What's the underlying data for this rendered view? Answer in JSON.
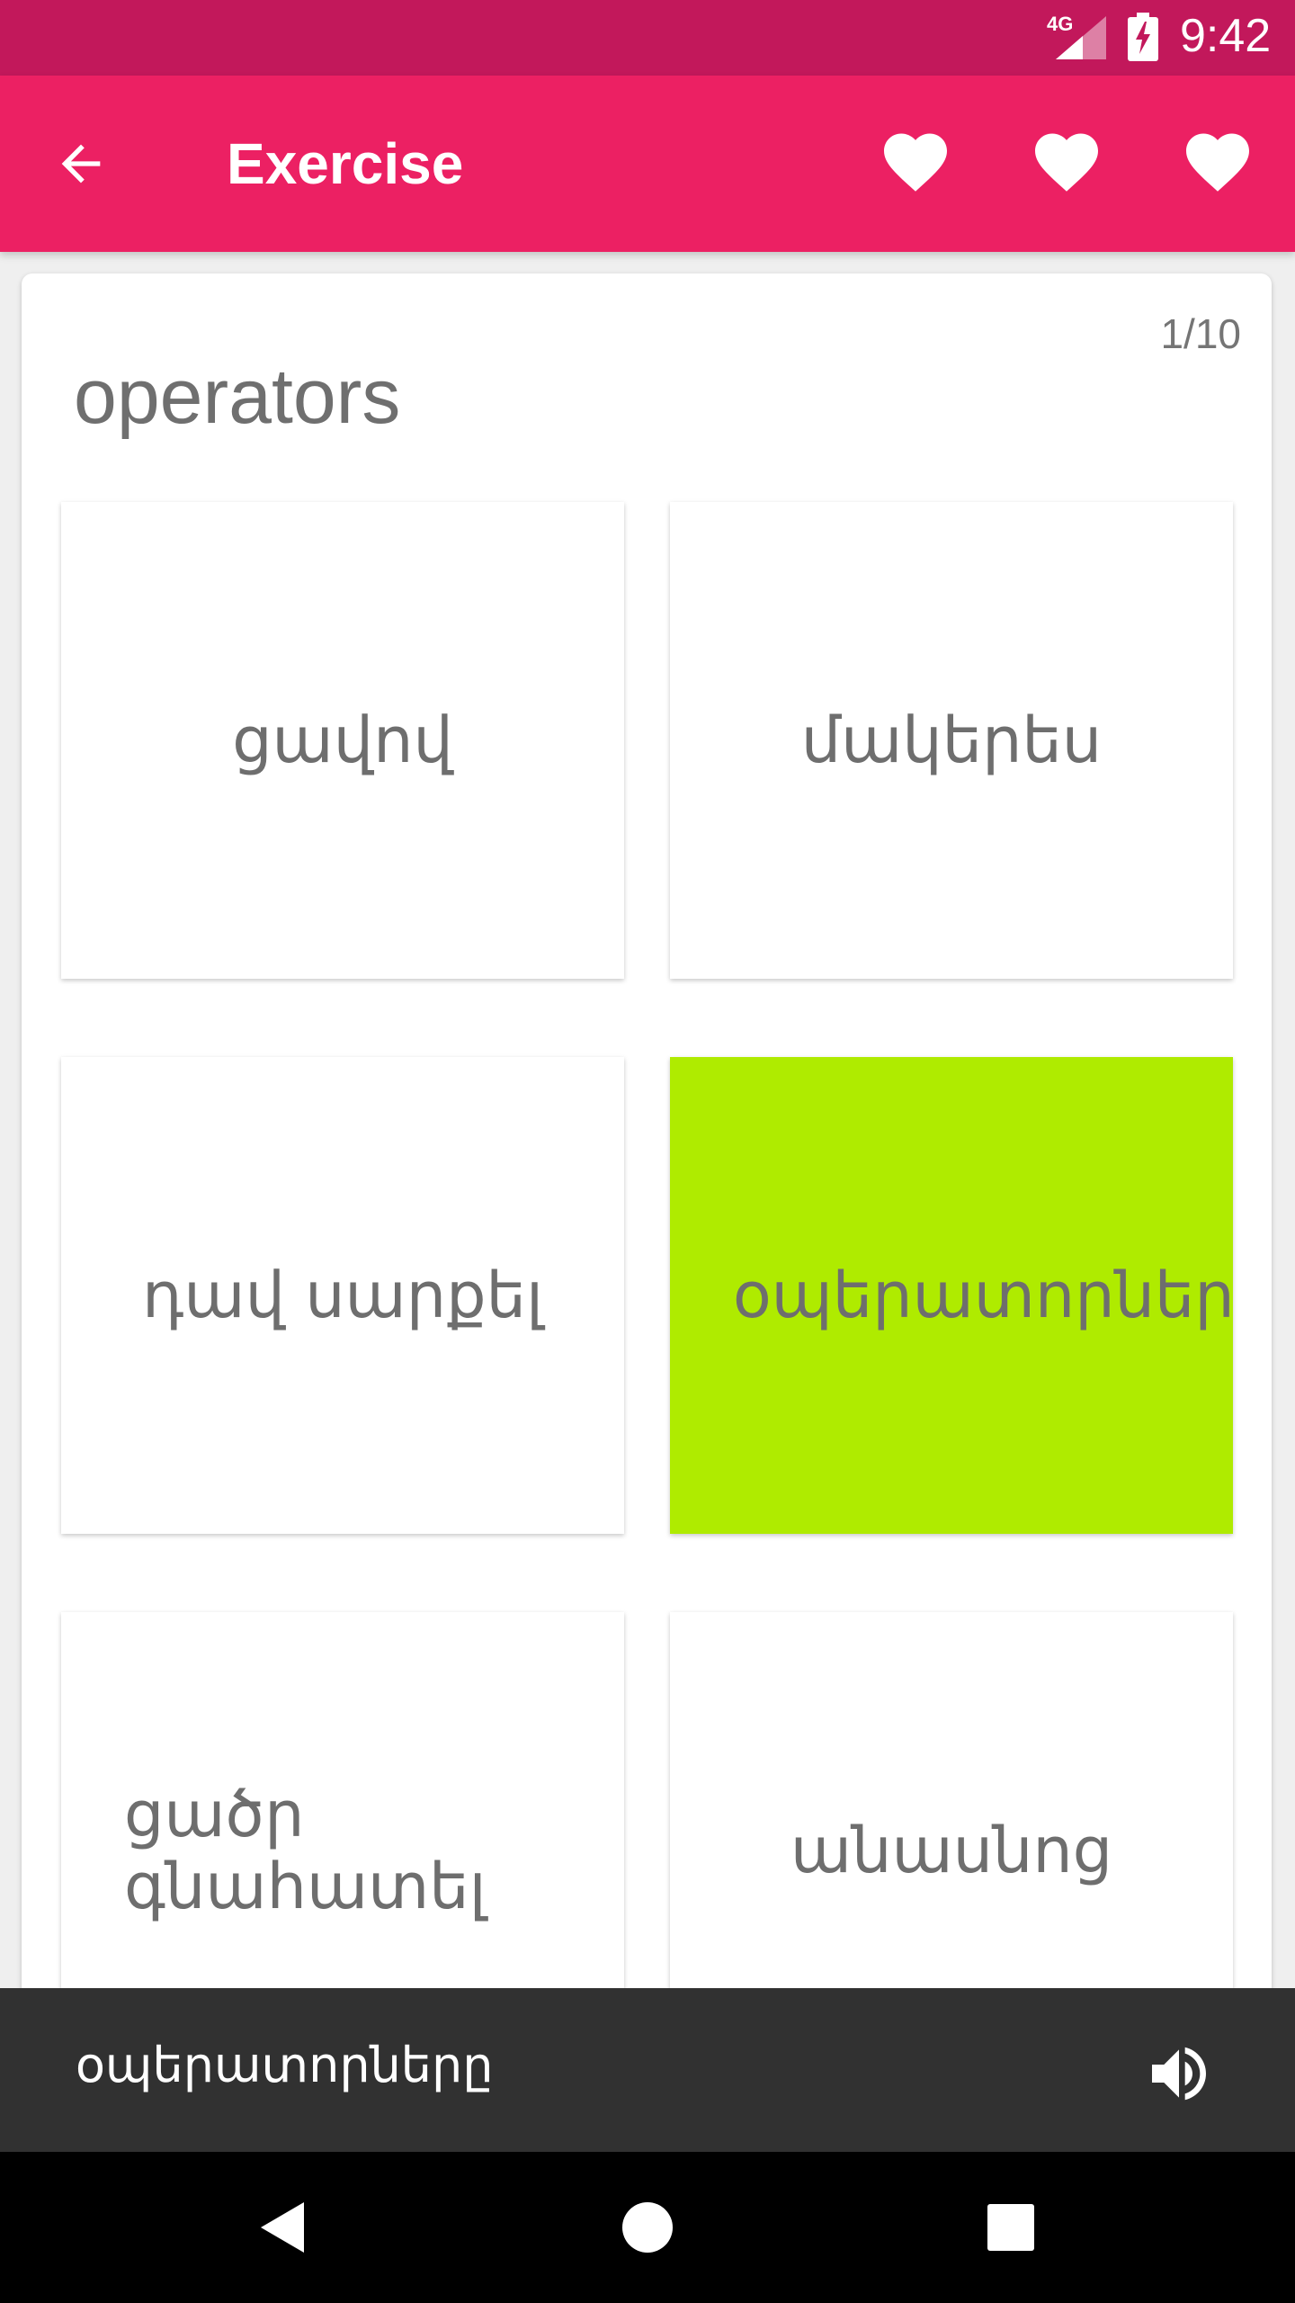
{
  "status_bar": {
    "network": "4G",
    "time": "9:42"
  },
  "app_bar": {
    "title": "Exercise",
    "back_icon": "arrow-back-icon",
    "lives_icon": "heart-icon",
    "lives": 3
  },
  "exercise": {
    "counter": "1/10",
    "word": "operators",
    "options": [
      {
        "label": "ցավով",
        "selected": false
      },
      {
        "label": "մակերես",
        "selected": false
      },
      {
        "label": "դավ սարքել",
        "selected": false
      },
      {
        "label": "օպերատորներ",
        "selected": true
      },
      {
        "label": "ցածր գնահատել",
        "selected": false
      },
      {
        "label": "անասնոց",
        "selected": false
      }
    ]
  },
  "translation_bar": {
    "text": "օպերատորները",
    "speaker_icon": "volume-up-icon"
  },
  "nav_bar": {
    "back_icon": "nav-back-icon",
    "home_icon": "nav-home-icon",
    "recents_icon": "nav-recents-icon"
  },
  "colors": {
    "status_bar": "#c2185b",
    "app_bar": "#ec2063",
    "selected_tile": "#afeb00",
    "translation_bar": "#313131"
  }
}
